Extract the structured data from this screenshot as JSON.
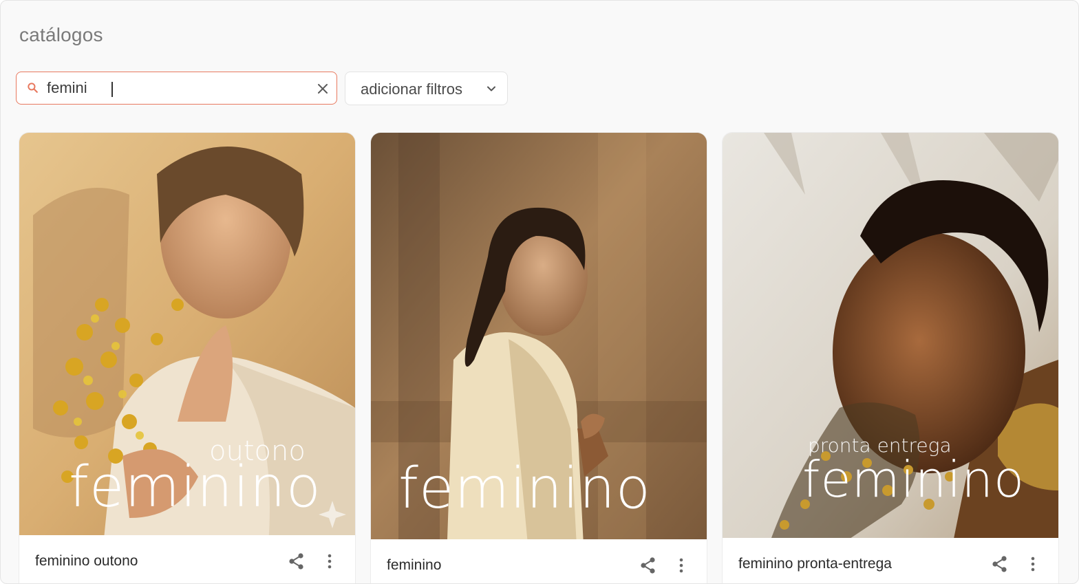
{
  "page": {
    "title": "catálogos"
  },
  "search": {
    "value": "femini"
  },
  "filters": {
    "label": "adicionar filtros"
  },
  "colors": {
    "accent": "#e8795f",
    "text": "#2b2b2b",
    "muted": "#7a7a7a"
  },
  "catalogs": [
    {
      "name": "feminino outono",
      "overlay_sub": "outono",
      "overlay_main": "feminino"
    },
    {
      "name": "feminino",
      "overlay_sub": "",
      "overlay_main": "feminino"
    },
    {
      "name": "feminino pronta-entrega",
      "overlay_sub": "pronta entrega",
      "overlay_main": "feminino"
    }
  ],
  "icons": {
    "search": "search-icon",
    "clear": "close-icon",
    "dropdown": "chevron-down-icon",
    "share": "share-icon",
    "more": "more-vertical-icon"
  }
}
